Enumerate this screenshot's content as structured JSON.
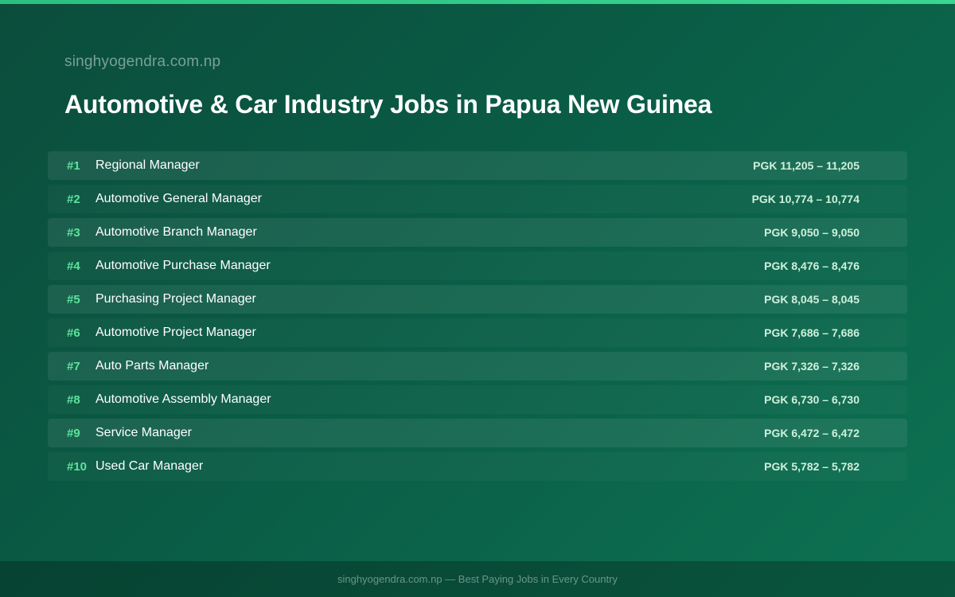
{
  "header": {
    "site_name": "singhyogendra.com.np",
    "title": "Automotive & Car Industry Jobs in Papua New Guinea"
  },
  "jobs": [
    {
      "rank": "#1",
      "title": "Regional Manager",
      "salary": "PGK 11,205 – 11,205"
    },
    {
      "rank": "#2",
      "title": "Automotive General Manager",
      "salary": "PGK 10,774 – 10,774"
    },
    {
      "rank": "#3",
      "title": "Automotive Branch Manager",
      "salary": "PGK 9,050 – 9,050"
    },
    {
      "rank": "#4",
      "title": "Automotive Purchase Manager",
      "salary": "PGK 8,476 – 8,476"
    },
    {
      "rank": "#5",
      "title": "Purchasing Project Manager",
      "salary": "PGK 8,045 – 8,045"
    },
    {
      "rank": "#6",
      "title": "Automotive Project Manager",
      "salary": "PGK 7,686 – 7,686"
    },
    {
      "rank": "#7",
      "title": "Auto Parts Manager",
      "salary": "PGK 7,326 – 7,326"
    },
    {
      "rank": "#8",
      "title": "Automotive Assembly Manager",
      "salary": "PGK 6,730 – 6,730"
    },
    {
      "rank": "#9",
      "title": "Service Manager",
      "salary": "PGK 6,472 – 6,472"
    },
    {
      "rank": "#10",
      "title": "Used Car Manager",
      "salary": "PGK 5,782 – 5,782"
    }
  ],
  "footer": {
    "text": "singhyogendra.com.np — Best Paying Jobs in Every Country"
  },
  "colors": {
    "accent": "#3ad590",
    "rank": "#5de39c",
    "background": "#0a5c45"
  }
}
